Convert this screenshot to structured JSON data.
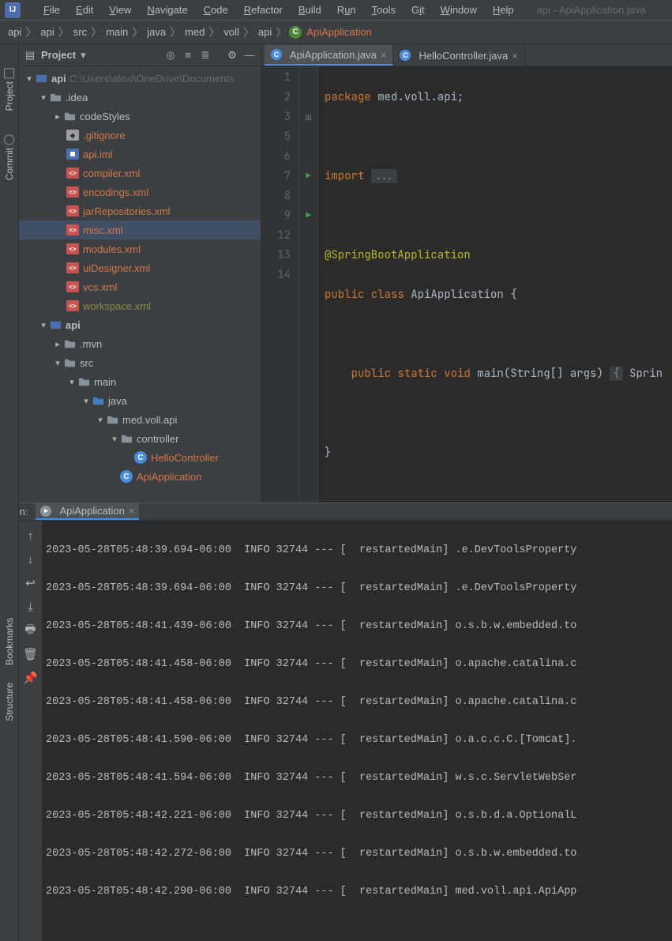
{
  "window": {
    "title": "api - ApiApplication.java"
  },
  "menu": {
    "file": "File",
    "edit": "Edit",
    "view": "View",
    "navigate": "Navigate",
    "code": "Code",
    "refactor": "Refactor",
    "build": "Build",
    "run": "Run",
    "tools": "Tools",
    "git": "Git",
    "window": "Window",
    "help": "Help"
  },
  "breadcrumbs": {
    "items": [
      "api",
      "api",
      "src",
      "main",
      "java",
      "med",
      "voll",
      "api"
    ],
    "leaf": "ApiApplication"
  },
  "leftTabs": {
    "project": "Project",
    "commit": "Commit",
    "bookmarks": "Bookmarks",
    "structure": "Structure"
  },
  "projectTool": {
    "label": "Project"
  },
  "tree": {
    "root": {
      "name": "api",
      "path": "C:\\Users\\alexi\\OneDrive\\Documents"
    },
    "idea": ".idea",
    "codeStyles": "codeStyles",
    "gitignore": ".gitignore",
    "apiIml": "api.iml",
    "compiler": "compiler.xml",
    "encodings": "encodings.xml",
    "jarRepos": "jarRepositories.xml",
    "misc": "misc.xml",
    "modules": "modules.xml",
    "uiDesigner": "uiDesigner.xml",
    "vcs": "vcs.xml",
    "workspace": "workspace.xml",
    "api2": "api",
    "mvn": ".mvn",
    "src": "src",
    "main": "main",
    "java": "java",
    "pkg": "med.voll.api",
    "controller": "controller",
    "helloCtrl": "HelloController",
    "apiApp": "ApiApplication"
  },
  "editorTabs": {
    "t1": "ApiApplication.java",
    "t2": "HelloController.java"
  },
  "lineNums": [
    "1",
    "2",
    "3",
    "5",
    "6",
    "7",
    "8",
    "9",
    "12",
    "13",
    "14"
  ],
  "code": {
    "l1_kw": "package",
    "l1_rest": " med.voll.api;",
    "l3_kw": "import",
    "l3_dim": "...",
    "l6_ann": "@SpringBootApplication",
    "l7_pub": "public ",
    "l7_cls": "class ",
    "l7_name": "ApiApplication ",
    "l7_br": "{",
    "l9_pre": "    ",
    "l9_pub": "public ",
    "l9_stat": "static ",
    "l9_void": "void ",
    "l9_main": "main",
    "l9_paren": "(",
    "l9_str": "String",
    "l9_arr": "[] ",
    "l9_args": "args",
    "l9_close": ") ",
    "l9_brace": "{",
    "l9_spr": " Sprin",
    "l13": "}"
  },
  "run": {
    "label": "Run:",
    "tab": "ApiApplication",
    "log": [
      "2023-05-28T05:48:39.694-06:00  INFO 32744 --- [  restartedMain] .e.DevToolsProperty",
      "2023-05-28T05:48:39.694-06:00  INFO 32744 --- [  restartedMain] .e.DevToolsProperty",
      "2023-05-28T05:48:41.439-06:00  INFO 32744 --- [  restartedMain] o.s.b.w.embedded.to",
      "2023-05-28T05:48:41.458-06:00  INFO 32744 --- [  restartedMain] o.apache.catalina.c",
      "2023-05-28T05:48:41.458-06:00  INFO 32744 --- [  restartedMain] o.apache.catalina.c",
      "2023-05-28T05:48:41.590-06:00  INFO 32744 --- [  restartedMain] o.a.c.c.C.[Tomcat].",
      "2023-05-28T05:48:41.594-06:00  INFO 32744 --- [  restartedMain] w.s.c.ServletWebSer",
      "2023-05-28T05:48:42.221-06:00  INFO 32744 --- [  restartedMain] o.s.b.d.a.OptionalL",
      "2023-05-28T05:48:42.272-06:00  INFO 32744 --- [  restartedMain] o.s.b.w.embedded.to",
      "2023-05-28T05:48:42.290-06:00  INFO 32744 --- [  restartedMain] med.voll.api.ApiApp"
    ]
  }
}
